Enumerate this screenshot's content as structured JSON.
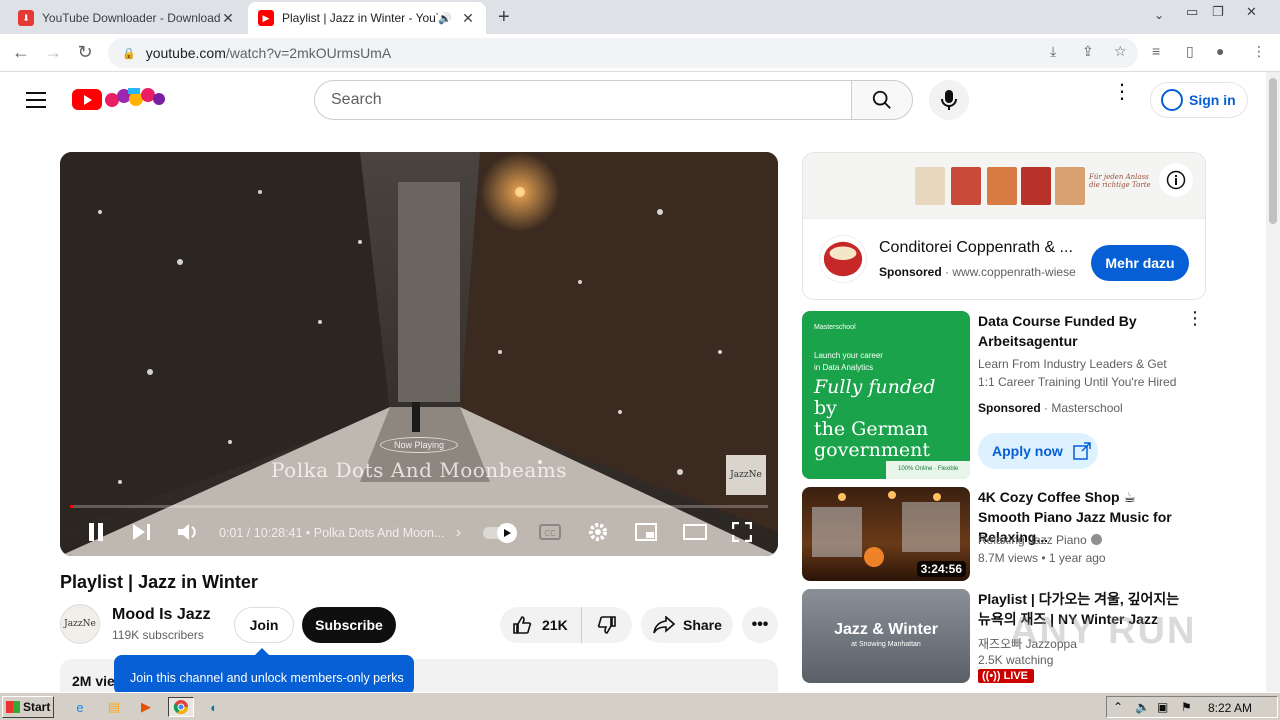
{
  "browser": {
    "tabs": [
      {
        "title": "YouTube Downloader - Download Yo",
        "active": false
      },
      {
        "title": "Playlist | Jazz in Winter - YouTub",
        "active": true
      }
    ],
    "url_host": "youtube.com",
    "url_path": "/watch?v=2mkOUrmsUmA"
  },
  "header": {
    "search_placeholder": "Search",
    "signin_label": "Sign in"
  },
  "player": {
    "now_playing": "Now Playing",
    "song_overlay": "Polka Dots And Moonbeams",
    "watermark": "JazzNe",
    "time": "0:01 / 10:28:41",
    "chapter": "Polka Dots And Moon...",
    "chapter_arrow": "›",
    "progress_fraction": 0.0
  },
  "video": {
    "title": "Playlist | Jazz in Winter",
    "channel_avatar_text": "JazzNe",
    "channel_name": "Mood Is Jazz",
    "subscribers": "119K subscribers",
    "join_label": "Join",
    "subscribe_label": "Subscribe",
    "likes": "21K",
    "share_label": "Share",
    "views": "2M vie",
    "join_tooltip": "Join this channel and unlock members-only perks"
  },
  "ad": {
    "banner_text": "Für jeden Anlass die richtige Torte",
    "advertiser": "Conditorei Coppenrath & ...",
    "sponsored": "Sponsored",
    "domain": "www.coppenrath-wiese",
    "cta": "Mehr dazu"
  },
  "recommendations": [
    {
      "title": "Data Course Funded By Arbeitsagentur",
      "desc": [
        "Learn From Industry Leaders & Get",
        "1:1 Career Training Until You're Hired"
      ],
      "sponsored": "Sponsored",
      "advertiser": "Masterschool",
      "cta": "Apply now",
      "thumb": {
        "brand": "Masterschool",
        "tagline1": "Launch your career",
        "tagline2": "in Data Analytics",
        "headline_1": "Fully funded",
        "headline_2": "by",
        "headline_3": "the German",
        "headline_4": "government",
        "footer": "100% Online · Flexible"
      }
    },
    {
      "title": "4K Cozy Coffee Shop ☕ Smooth Piano Jazz Music for Relaxing...",
      "channel": "Relaxing Jazz Piano",
      "meta": "8.7M views  •  1 year ago",
      "duration": "3:24:56"
    },
    {
      "title": "Playlist | 다가오는 겨울, 깊어지는 뉴욕의 재즈 | NY Winter Jazz",
      "channel": "재즈오빠 Jazzoppa",
      "meta": "2.5K watching",
      "live": "LIVE",
      "thumb_title": "Jazz & Winter",
      "thumb_sub": "at Snowing Manhattan"
    }
  ],
  "watermark_text": "ANY RUN",
  "taskbar": {
    "start_label": "Start",
    "clock": "8:22 AM"
  },
  "colors": {
    "youtube_red": "#ff0000",
    "link_blue": "#065fd4",
    "masterschool_green": "#1aa34a"
  }
}
